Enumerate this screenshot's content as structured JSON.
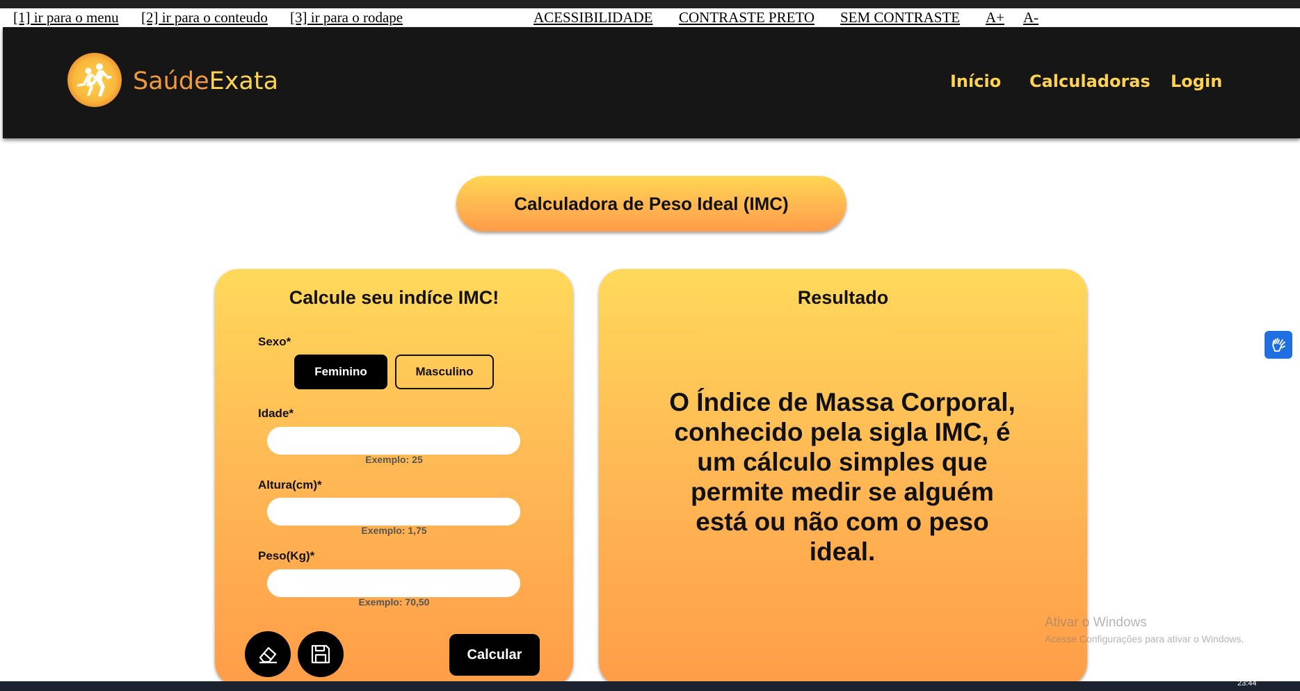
{
  "accessibility_bar": {
    "skip_menu": "[1] ir para o menu",
    "skip_content": "[2] ir para o conteudo",
    "skip_footer": "[3] ir para o rodape",
    "accessibility": "ACESSIBILIDADE",
    "contrast_black": "CONTRASTE PRETO",
    "no_contrast": "SEM CONTRASTE",
    "font_increase": "A+",
    "font_decrease": "A-"
  },
  "header": {
    "brand_part1": "Saúde",
    "brand_part2": "Exata",
    "logo_icon": "running-people-icon",
    "nav": {
      "home": "Início",
      "calculators": "Calculadoras",
      "login": "Login"
    }
  },
  "page_title": "Calculadora de Peso Ideal (IMC)",
  "form": {
    "title": "Calcule seu indíce IMC!",
    "sex_label": "Sexo*",
    "sex_options": [
      "Feminino",
      "Masculino"
    ],
    "sex_selected": "Feminino",
    "age_label": "Idade*",
    "age_value": "",
    "age_example": "Exemplo: 25",
    "height_label": "Altura(cm)*",
    "height_value": "",
    "height_example": "Exemplo: 1,75",
    "weight_label": "Peso(Kg)*",
    "weight_value": "",
    "weight_example": "Exemplo: 70,50",
    "clear_icon": "eraser-icon",
    "save_icon": "floppy-disk-icon",
    "calculate_label": "Calcular"
  },
  "result": {
    "title": "Resultado",
    "text": "O Índice de Massa Corporal, conhecido pela sigla IMC, é um cálculo simples que permite medir se alguém está ou não com o peso ideal."
  },
  "watermark": {
    "line1": "Ativar o Windows",
    "line2": "Acesse Configurações para ativar o Windows."
  },
  "taskbar": {
    "clock": "23:44"
  },
  "colors": {
    "header_bg": "#161616",
    "brand_orange": "#f49a3e",
    "brand_yellow": "#ffd352",
    "card_top": "#ffd95a",
    "card_bottom": "#ff9d48",
    "vlibras_blue": "#1f6fe0"
  }
}
